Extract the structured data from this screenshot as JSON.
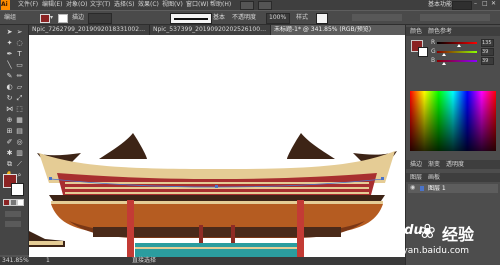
{
  "app": {
    "logo": "Ai"
  },
  "menu": {
    "items": [
      "文件(F)",
      "编辑(E)",
      "对象(O)",
      "文字(T)",
      "选择(S)",
      "效果(C)",
      "视图(V)",
      "窗口(W)",
      "帮助(H)"
    ],
    "workspace": "基本功能"
  },
  "control": {
    "selection": "编组",
    "stroke_label": "描边",
    "stroke_style": "基本",
    "opacity_label": "不透明度",
    "opacity_value": "100%",
    "style_label": "样式"
  },
  "tabs": [
    {
      "label": "Npic_7262799_20190920183310020831.ai*",
      "active": false
    },
    {
      "label": "Npic_537399_201909202025261000.ai*",
      "active": false
    },
    {
      "label": "未标题-1* @ 341.85% (RGB/预览)",
      "active": true
    }
  ],
  "status": {
    "zoom": "341.85%",
    "page": "1",
    "tool": "直接选择"
  },
  "panels": {
    "color_tab": "颜色",
    "color_guide_tab": "颜色参考",
    "swatch_tabs": [
      "描边",
      "渐变",
      "透明度"
    ],
    "layers_tabs": [
      "图层",
      "画板"
    ],
    "layer_name": "图层 1",
    "color_values": [
      "135",
      "39",
      "39"
    ]
  },
  "colors": {
    "fill": "#8b2323",
    "roof_trim": "#a82f2f",
    "roof_band": "#e5cc95",
    "roof_dark": "#3d2416",
    "eave_brown": "#b55c21",
    "column": "#c33b35",
    "teal": "#2b9d9f"
  },
  "watermark": {
    "brand": "Baidu",
    "text": "经验",
    "url": "jingyan.baidu.com"
  }
}
